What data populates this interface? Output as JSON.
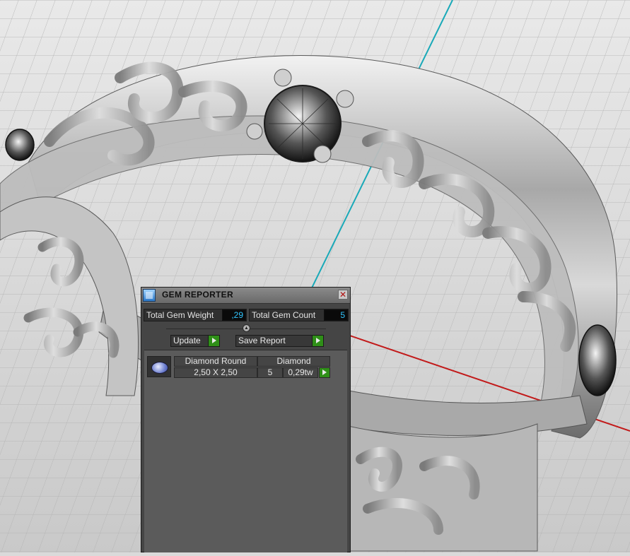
{
  "panel": {
    "title": "GEM REPORTER",
    "close_symbol": "✕",
    "total_weight_label": "Total Gem Weight",
    "total_weight_value": ",29",
    "total_count_label": "Total Gem Count",
    "total_count_value": "5",
    "update_label": "Update",
    "save_report_label": "Save Report",
    "gems": [
      {
        "name": "Diamond Round",
        "material": "Diamond",
        "size": "2,50 X 2,50",
        "count": "5",
        "weight": "0,29tw"
      }
    ]
  },
  "icons": {
    "app": "gem-reporter-icon",
    "close": "close-icon",
    "splitter": "splitter-knob-icon",
    "play": "play-arrow-icon",
    "gem": "round-gem-icon"
  },
  "colors": {
    "panel_bg": "#454545",
    "value_text": "#31c6ff",
    "action_green": "#2f8f18",
    "grid_line": "#b5b5b5",
    "axis_cyan": "#19a9b8",
    "axis_red": "#c21a1a"
  }
}
